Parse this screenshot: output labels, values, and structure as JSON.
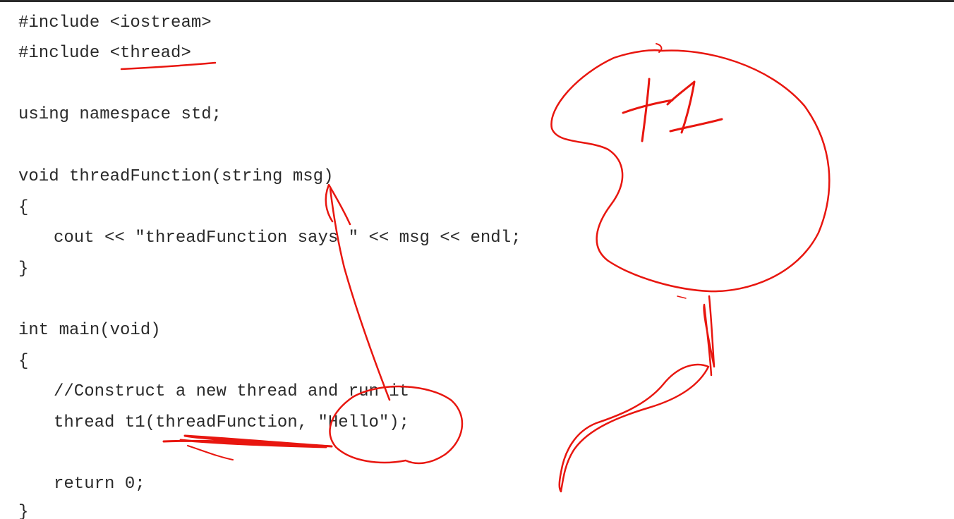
{
  "code": {
    "lines": [
      "#include <iostream>",
      "#include <thread>",
      "using namespace std;",
      "void threadFunction(string msg)",
      "{",
      "cout << \"threadFunction says \" << msg << endl;",
      "}",
      "int main(void)",
      "{",
      "//Construct a new thread and run it",
      "thread t1(threadFunction, \"Hello\");",
      "return 0;",
      "}"
    ]
  },
  "annotations": {
    "ink_color": "#e8160f",
    "thread_label": "t1"
  }
}
